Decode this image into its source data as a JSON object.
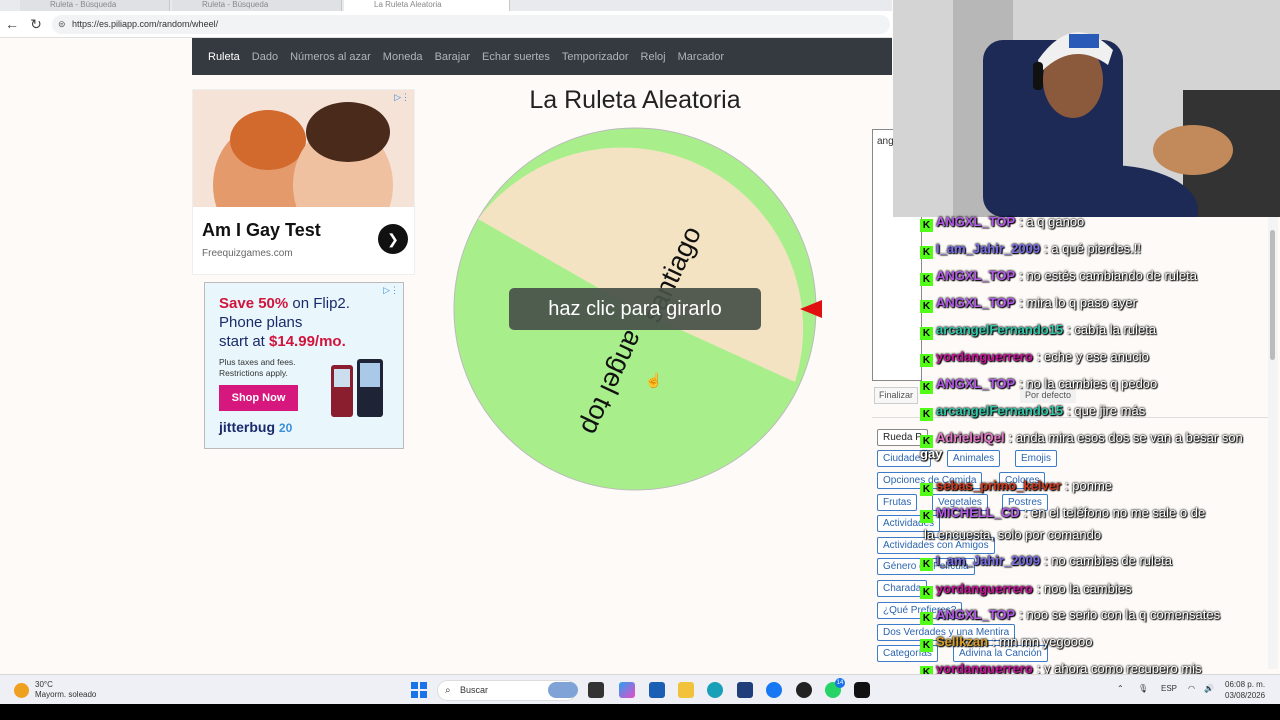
{
  "browser": {
    "tabs": [
      {
        "label": "Ruleta - Búsqueda"
      },
      {
        "label": "Ruleta - Búsqueda"
      },
      {
        "label": "La Ruleta Aleatoria"
      }
    ],
    "url": "https://es.piliapp.com/random/wheel/"
  },
  "site_nav": {
    "items": [
      "Ruleta",
      "Dado",
      "Números al azar",
      "Moneda",
      "Barajar",
      "Echar suertes",
      "Temporizador",
      "Reloj",
      "Marcador"
    ],
    "active": "Ruleta"
  },
  "ads": {
    "ad1": {
      "title": "Am I Gay Test",
      "sub": "Freequizgames.com"
    },
    "ad2": {
      "save": "Save 50%",
      "on": " on Flip2.",
      "line2": "Phone plans",
      "line3_prefix": "start at ",
      "price": "$14.99/mo.",
      "small": "Plus taxes and fees. Restrictions apply.",
      "shop": "Shop Now",
      "brand": "jitterbug",
      "years": "20"
    }
  },
  "wheel": {
    "title": "La Ruleta Aleatoria",
    "spin_label": "haz clic para girarlo",
    "segments": [
      {
        "label": "santiago",
        "color": "#f3e3c3"
      },
      {
        "label": "angel top",
        "color": "#a8ef8c"
      }
    ],
    "pointer_color": "#e01010"
  },
  "panel": {
    "entries_text": "ang sant",
    "finalize": "Finalizar",
    "default": "Por defecto",
    "categories": [
      "Rueda P",
      "Ciudades",
      "Animales",
      "Emojis",
      "Opciones de Comida",
      "Colores",
      "Frutas",
      "Vegetales",
      "Postres",
      "Actividades",
      "Actividades con Amigos",
      "Género de Película",
      "Charada",
      "¿Qué Prefieres?",
      "Dos Verdades y una Mentira",
      "Categorías",
      "Adivina la Canción"
    ]
  },
  "chat": [
    {
      "user": "ANGXL_TOP",
      "color": "#b45ae8",
      "msg": ": a q ganoo"
    },
    {
      "user": "I_am_Jahir_2009",
      "color": "#7a6ee8",
      "msg": ": a qué pierdes.!!"
    },
    {
      "user": "ANGXL_TOP",
      "color": "#b45ae8",
      "msg": ": no estés cambiando de ruleta"
    },
    {
      "user": "ANGXL_TOP",
      "color": "#b45ae8",
      "msg": ": mira lo q paso ayer"
    },
    {
      "user": "arcangelFernando15",
      "color": "#30c8a8",
      "msg": ": cabía la ruleta"
    },
    {
      "user": "yordanguerrero",
      "color": "#c8149a",
      "msg": ": eche y ese anucio"
    },
    {
      "user": "ANGXL_TOP",
      "color": "#b45ae8",
      "msg": ": no la cambies q pedoo"
    },
    {
      "user": "arcangelFernando15",
      "color": "#30c8a8",
      "msg": ": que jire más"
    },
    {
      "user": "AdrielelQel",
      "color": "#e879c9",
      "msg": ": anda mira esos dos se van a besar son"
    },
    {
      "user": "gay",
      "color": "#ffffff",
      "msg": ""
    },
    {
      "user": "sebas_primo_kelver",
      "color": "#d23b1e",
      "msg": ": ponme"
    },
    {
      "user": "MICHELL_CD",
      "color": "#b45ae8",
      "msg": ": en el teléfono no me sale o de"
    },
    {
      "user": "",
      "color": "#ffffff",
      "msg": "la encuesta, solo por comando"
    },
    {
      "user": "I_am_Jahir_2009",
      "color": "#7a6ee8",
      "msg": ": no cambies de ruleta"
    },
    {
      "user": "yordanguerrero",
      "color": "#c8149a",
      "msg": ": noo la cambies"
    },
    {
      "user": "ANGXL_TOP",
      "color": "#b45ae8",
      "msg": ": noo se serio con la q comensates"
    },
    {
      "user": "Sellkzan",
      "color": "#d8a02a",
      "msg": ": mn mn yegoooo"
    },
    {
      "user": "yordanguerrero",
      "color": "#c8149a",
      "msg": ": y ahora como recupero mis"
    }
  ],
  "taskbar": {
    "temp": "30°C",
    "weather": "Mayorm. soleado",
    "search": "Buscar",
    "lang": "ESP",
    "time": "06:08 p. m.",
    "date": "03/08/2026",
    "badge": "14"
  }
}
